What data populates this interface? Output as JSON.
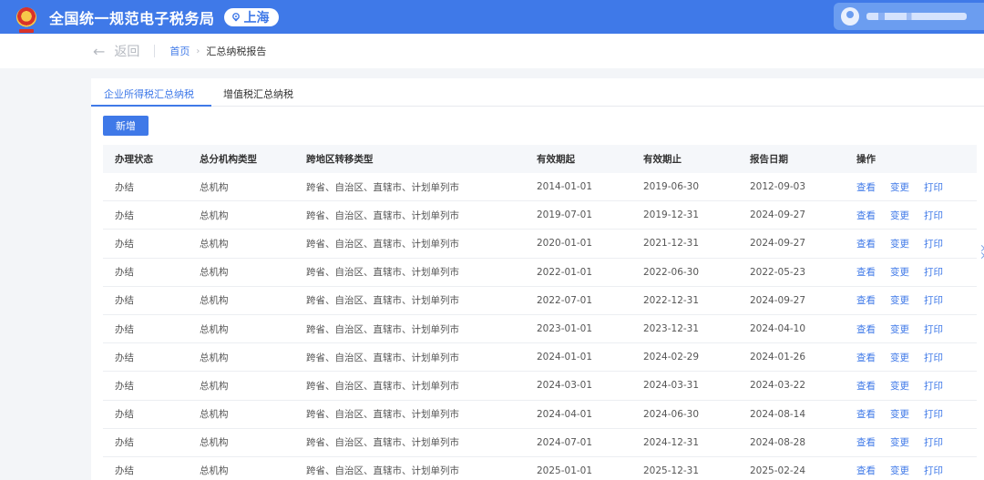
{
  "header": {
    "title": "全国统一规范电子税务局",
    "region": "上海",
    "accent": "#3f79e8"
  },
  "crumbbar": {
    "back_label": "返回",
    "breadcrumb_home": "首页",
    "breadcrumb_current": "汇总纳税报告"
  },
  "tabs": [
    {
      "label": "企业所得税汇总纳税",
      "active": true
    },
    {
      "label": "增值税汇总纳税",
      "active": false
    }
  ],
  "toolbar": {
    "new_label": "新增"
  },
  "table": {
    "columns": [
      "办理状态",
      "总分机构类型",
      "跨地区转移类型",
      "有效期起",
      "有效期止",
      "报告日期",
      "操作"
    ],
    "actions": [
      "查看",
      "变更",
      "打印"
    ],
    "rows": [
      [
        "办结",
        "总机构",
        "跨省、自治区、直辖市、计划单列市",
        "2014-01-01",
        "2019-06-30",
        "2012-09-03"
      ],
      [
        "办结",
        "总机构",
        "跨省、自治区、直辖市、计划单列市",
        "2019-07-01",
        "2019-12-31",
        "2024-09-27"
      ],
      [
        "办结",
        "总机构",
        "跨省、自治区、直辖市、计划单列市",
        "2020-01-01",
        "2021-12-31",
        "2024-09-27"
      ],
      [
        "办结",
        "总机构",
        "跨省、自治区、直辖市、计划单列市",
        "2022-01-01",
        "2022-06-30",
        "2022-05-23"
      ],
      [
        "办结",
        "总机构",
        "跨省、自治区、直辖市、计划单列市",
        "2022-07-01",
        "2022-12-31",
        "2024-09-27"
      ],
      [
        "办结",
        "总机构",
        "跨省、自治区、直辖市、计划单列市",
        "2023-01-01",
        "2023-12-31",
        "2024-04-10"
      ],
      [
        "办结",
        "总机构",
        "跨省、自治区、直辖市、计划单列市",
        "2024-01-01",
        "2024-02-29",
        "2024-01-26"
      ],
      [
        "办结",
        "总机构",
        "跨省、自治区、直辖市、计划单列市",
        "2024-03-01",
        "2024-03-31",
        "2024-03-22"
      ],
      [
        "办结",
        "总机构",
        "跨省、自治区、直辖市、计划单列市",
        "2024-04-01",
        "2024-06-30",
        "2024-08-14"
      ],
      [
        "办结",
        "总机构",
        "跨省、自治区、直辖市、计划单列市",
        "2024-07-01",
        "2024-12-31",
        "2024-08-28"
      ],
      [
        "办结",
        "总机构",
        "跨省、自治区、直辖市、计划单列市",
        "2025-01-01",
        "2025-12-31",
        "2025-02-24"
      ]
    ]
  }
}
